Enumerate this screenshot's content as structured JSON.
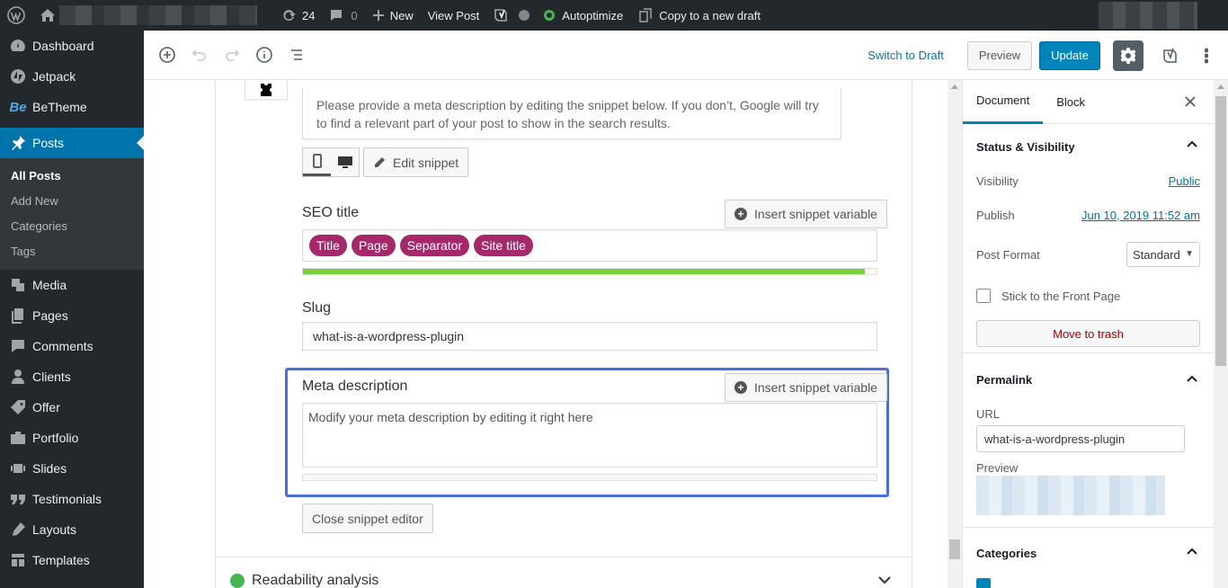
{
  "adminbar": {
    "updates_count": "24",
    "comments_count": "0",
    "new_label": "New",
    "view_post_label": "View Post",
    "autoptimize_label": "Autoptimize",
    "copy_draft_label": "Copy to a new draft"
  },
  "sidebar": {
    "items": [
      {
        "label": "Dashboard",
        "icon": "dashboard-icon"
      },
      {
        "label": "Jetpack",
        "icon": "jetpack-icon"
      },
      {
        "label": "BeTheme",
        "icon": "betheme-logo",
        "logo_text": "Be"
      },
      {
        "label": "Posts",
        "icon": "pin-icon"
      },
      {
        "label": "Media",
        "icon": "media-icon"
      },
      {
        "label": "Pages",
        "icon": "pages-icon"
      },
      {
        "label": "Comments",
        "icon": "comments-icon"
      },
      {
        "label": "Clients",
        "icon": "clients-icon"
      },
      {
        "label": "Offer",
        "icon": "offer-icon"
      },
      {
        "label": "Portfolio",
        "icon": "portfolio-icon"
      },
      {
        "label": "Slides",
        "icon": "slides-icon"
      },
      {
        "label": "Testimonials",
        "icon": "testimonials-icon"
      },
      {
        "label": "Layouts",
        "icon": "layouts-icon"
      },
      {
        "label": "Templates",
        "icon": "templates-icon"
      }
    ],
    "submenu": [
      "All Posts",
      "Add New",
      "Categories",
      "Tags"
    ]
  },
  "header": {
    "switch_to_draft": "Switch to Draft",
    "preview": "Preview",
    "update": "Update"
  },
  "editor": {
    "snippet_help": "Please provide a meta description by editing the snippet below. If you don’t, Google will try to find a relevant part of your post to show in the search results.",
    "edit_snippet": "Edit snippet",
    "seo_title_label": "SEO title",
    "insert_variable": "Insert snippet variable",
    "seo_pills": [
      "Title",
      "Page",
      "Separator",
      "Site title"
    ],
    "seo_progress_percent": 98,
    "slug_label": "Slug",
    "slug_value": "what-is-a-wordpress-plugin",
    "meta_label": "Meta description",
    "meta_placeholder": "Modify your meta description by editing it right here",
    "close_editor": "Close snippet editor",
    "readability": "Readability analysis"
  },
  "settings": {
    "tabs": [
      "Document",
      "Block"
    ],
    "status_title": "Status & Visibility",
    "visibility_label": "Visibility",
    "visibility_value": "Public",
    "publish_label": "Publish",
    "publish_value": "Jun 10, 2019 11:52 am",
    "post_format_label": "Post Format",
    "post_format_value": "Standard",
    "sticky_label": "Stick to the Front Page",
    "trash_label": "Move to trash",
    "permalink_title": "Permalink",
    "url_label": "URL",
    "url_value": "what-is-a-wordpress-plugin",
    "preview_label": "Preview",
    "categories_title": "Categories"
  },
  "colors": {
    "primary": "#0085ba",
    "admin_dark": "#23282d",
    "yoast_pill": "#a4286a",
    "progress_good": "#7ad03a",
    "focus_border": "#4a6ee0"
  }
}
